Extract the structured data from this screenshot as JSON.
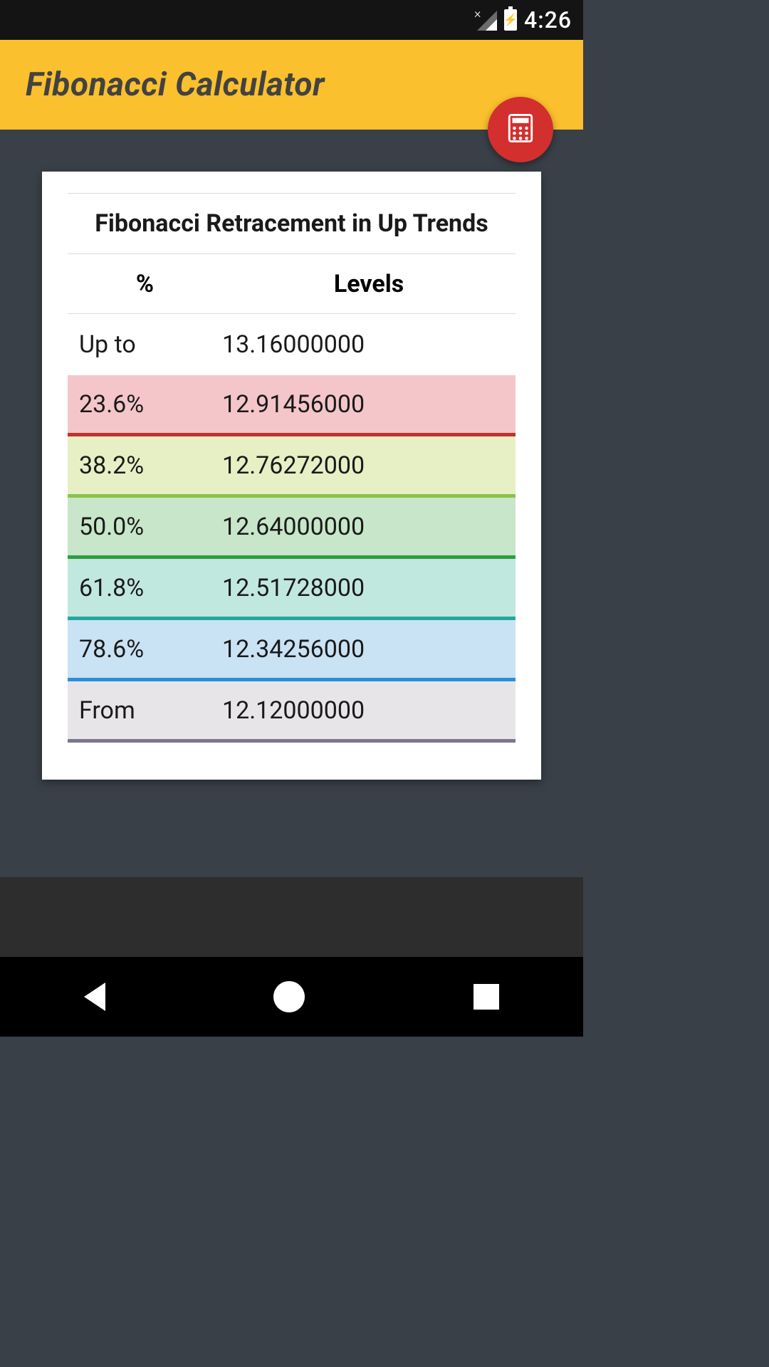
{
  "status": {
    "time": "4:26"
  },
  "header": {
    "title": "Fibonacci Calculator"
  },
  "card": {
    "title": "Fibonacci Retracement in Up Trends",
    "columns": {
      "pct": "%",
      "levels": "Levels"
    },
    "rows": {
      "upto": {
        "pct": "Up to",
        "level": "13.16000000"
      },
      "r236": {
        "pct": "23.6%",
        "level": "12.91456000"
      },
      "r382": {
        "pct": "38.2%",
        "level": "12.76272000"
      },
      "r500": {
        "pct": "50.0%",
        "level": "12.64000000"
      },
      "r618": {
        "pct": "61.8%",
        "level": "12.51728000"
      },
      "r786": {
        "pct": "78.6%",
        "level": "12.34256000"
      },
      "from": {
        "pct": "From",
        "level": "12.12000000"
      }
    }
  }
}
